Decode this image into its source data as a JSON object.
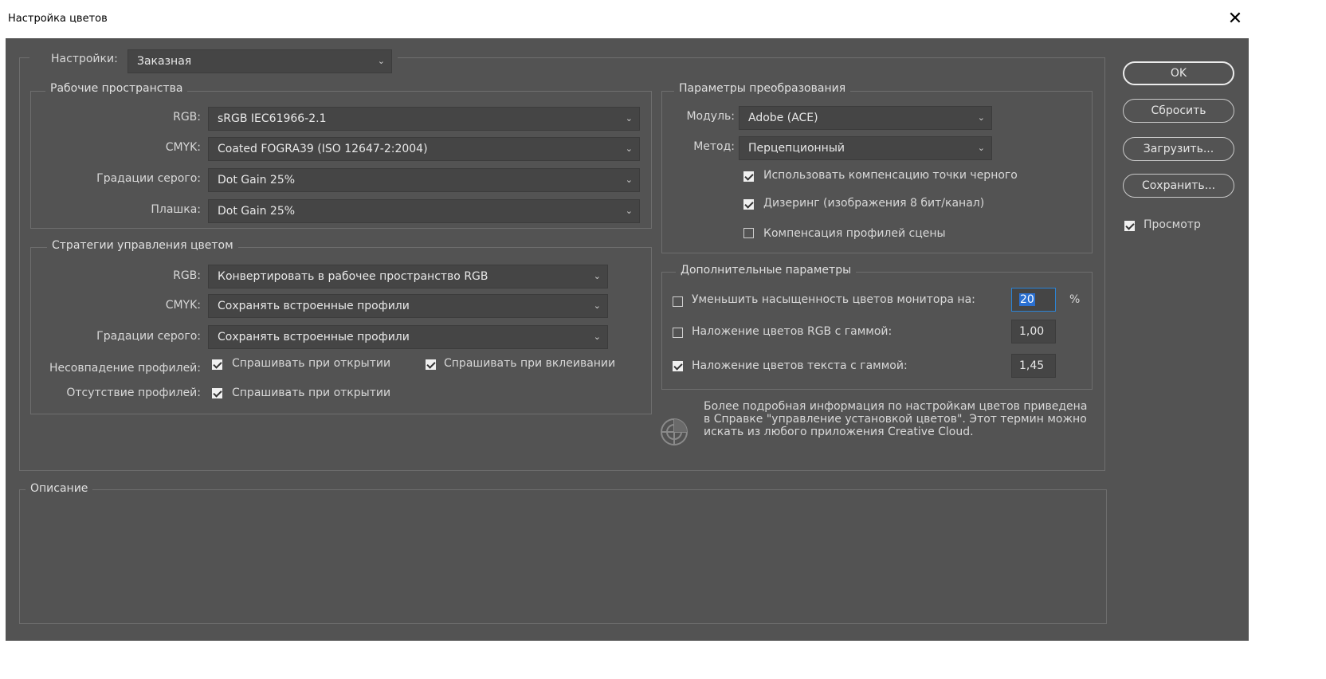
{
  "window": {
    "title": "Настройка цветов",
    "close_glyph": "✕"
  },
  "settings": {
    "label": "Настройки:",
    "value": "Заказная"
  },
  "working_spaces": {
    "legend": "Рабочие пространства",
    "rgb": {
      "label": "RGB:",
      "value": "sRGB IEC61966-2.1"
    },
    "cmyk": {
      "label": "CMYK:",
      "value": "Coated FOGRA39 (ISO 12647-2:2004)"
    },
    "gray": {
      "label": "Градации серого:",
      "value": "Dot Gain 25%"
    },
    "spot": {
      "label": "Плашка:",
      "value": "Dot Gain 25%"
    }
  },
  "policies": {
    "legend": "Стратегии управления цветом",
    "rgb": {
      "label": "RGB:",
      "value": "Конвертировать в рабочее пространство RGB"
    },
    "cmyk": {
      "label": "CMYK:",
      "value": "Сохранять встроенные профили"
    },
    "gray": {
      "label": "Градации серого:",
      "value": "Сохранять встроенные профили"
    },
    "mismatch_label": "Несовпадение профилей:",
    "mismatch_open": {
      "label": "Спрашивать при открытии",
      "checked": true
    },
    "mismatch_paste": {
      "label": "Спрашивать при вклеивании",
      "checked": true
    },
    "missing_label": "Отсутствие профилей:",
    "missing_open": {
      "label": "Спрашивать при открытии",
      "checked": true
    }
  },
  "conversion": {
    "legend": "Параметры преобразования",
    "engine": {
      "label": "Модуль:",
      "value": "Adobe (ACE)"
    },
    "intent": {
      "label": "Метод:",
      "value": "Перцепционный"
    },
    "bpc": {
      "label": "Использовать компенсацию точки черного",
      "checked": true
    },
    "dither": {
      "label": "Дизеринг (изображения 8 бит/канал)",
      "checked": true
    },
    "scene": {
      "label": "Компенсация профилей сцены",
      "checked": false
    }
  },
  "advanced": {
    "legend": "Дополнительные параметры",
    "desaturate": {
      "label": "Уменьшить насыщенность цветов монитора на:",
      "checked": false,
      "value": "20",
      "unit": "%"
    },
    "blend_rgb": {
      "label": "Наложение цветов RGB с гаммой:",
      "checked": false,
      "value": "1,00"
    },
    "blend_text": {
      "label": "Наложение цветов текста с гаммой:",
      "checked": true,
      "value": "1,45"
    }
  },
  "info_text": "Более подробная информация по настройкам цветов приведена в Справке \"управление установкой цветов\". Этот термин можно искать из любого приложения Creative Cloud.",
  "description": {
    "legend": "Описание"
  },
  "buttons": {
    "ok": "OK",
    "reset": "Сбросить",
    "load": "Загрузить...",
    "save": "Сохранить...",
    "preview": {
      "label": "Просмотр",
      "checked": true
    }
  }
}
